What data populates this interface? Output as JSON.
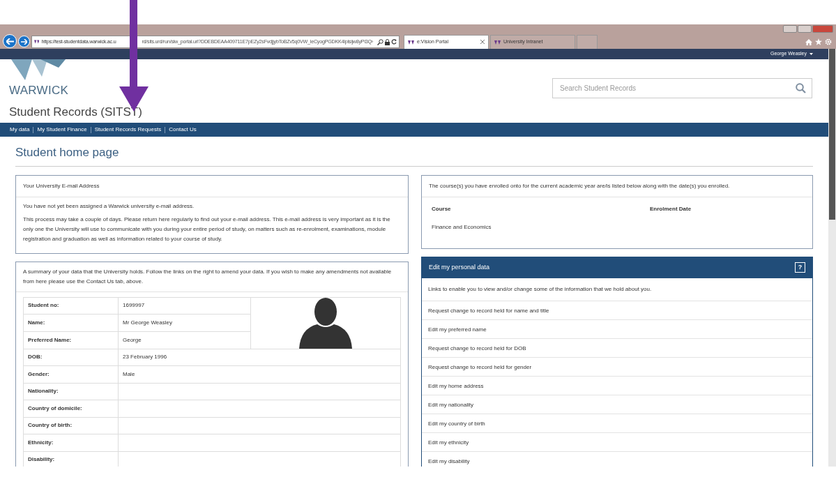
{
  "browser": {
    "address_before": "https://test-studentdata.warwick.ac.u",
    "address_after": "rd/sits.urd/run/siw_portal.url?DDEBDEAA409711E7pEZy2sFvdjjybToBZv5q0VW_leCyogPGDKK4lplsijw8yPi3Q›",
    "tabs": [
      {
        "label": "e:Vision Portal",
        "selected": true
      },
      {
        "label": "University Intranet",
        "selected": false
      }
    ]
  },
  "user_menu": "George Weasley",
  "header": {
    "logo": "WARWICK",
    "title": "Student Records (SITST)",
    "search": {
      "placeholder": "Search Student Records"
    }
  },
  "nav": [
    "My data",
    "My Student Finance",
    "Student Records Requests",
    "Contact Us"
  ],
  "page_title": "Student home page",
  "email_panel": {
    "title": "Your University E-mail Address",
    "paragraphs": [
      "You have not yet been assigned a Warwick university e-mail address.",
      "This process may take a couple of days. Please return here regularly to find out your e-mail address. This e-mail address is very important as it is the only one the University will use to communicate with you during your entire period of study, on matters such as re-enrolment, examinations, module registration and graduation as well as information related to your course of study."
    ]
  },
  "summary_panel": {
    "intro": "A summary of your data that the University holds. Follow the links on the right to amend your data. If you wish to make any amendments not available from here please use the Contact Us tab, above.",
    "rows": [
      {
        "label": "Student no:",
        "value": "1699997"
      },
      {
        "label": "Name:",
        "value": "Mr George Weasley"
      },
      {
        "label": "Preferred Name:",
        "value": "George"
      },
      {
        "label": "DOB:",
        "value": "23 February 1996"
      },
      {
        "label": "Gender:",
        "value": "Male"
      },
      {
        "label": "Nationality:"
      },
      {
        "label": "Country of domicile:"
      },
      {
        "label": "Country of birth:"
      },
      {
        "label": "Ethnicity:"
      },
      {
        "label": "Disability:"
      }
    ]
  },
  "course_panel": {
    "title": "The course(s) you have enrolled onto for the current academic year are/is listed below along with the date(s) you enrolled.",
    "columns": [
      "Course",
      "Enrolment Date"
    ],
    "rows": [
      [
        "Finance and Economics"
      ]
    ]
  },
  "personal_panel": {
    "title": "Edit my personal data",
    "help": "?",
    "intro": "Links to enable you to view and/or change some of the information that we hold about you.",
    "links": [
      "Request change to record held for name and title",
      "Edit my preferred name",
      "Request change to record held for DOB",
      "Request change to record held for gender",
      "Edit my home address",
      "Edit my nationality",
      "Edit my country of birth",
      "Edit my ethnicity",
      "Edit my disability"
    ]
  }
}
